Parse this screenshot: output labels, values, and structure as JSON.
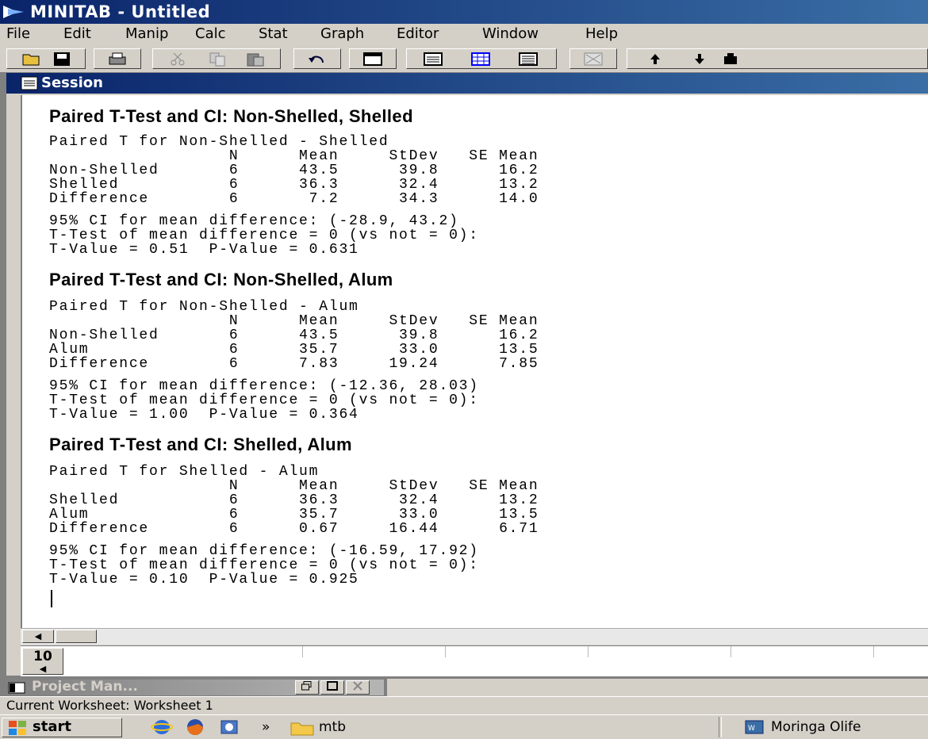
{
  "app": {
    "title": "MINITAB - Untitled"
  },
  "menu": [
    "File",
    "Edit",
    "Manip",
    "Calc",
    "Stat",
    "Graph",
    "Editor",
    "Window",
    "Help"
  ],
  "toolbar_icons": [
    "open-icon",
    "save-icon",
    "print-icon",
    "cut-icon",
    "copy-icon",
    "paste-icon",
    "undo-icon",
    "data-window-icon",
    "session-window-icon",
    "worksheet-icon",
    "info-icon",
    "history-icon",
    "up-arrow-icon",
    "down-arrow-icon",
    "more-icon"
  ],
  "session": {
    "title": "Session",
    "blocks": [
      {
        "header": "Paired T-Test and CI: Non-Shelled, Shelled",
        "lines": [
          "Paired T for Non-Shelled - Shelled",
          "                  N      Mean     StDev   SE Mean",
          "Non-Shelled       6      43.5      39.8      16.2",
          "Shelled           6      36.3      32.4      13.2",
          "Difference        6       7.2      34.3      14.0",
          "",
          "95% CI for mean difference: (-28.9, 43.2)",
          "T-Test of mean difference = 0 (vs not = 0):",
          "T-Value = 0.51  P-Value = 0.631"
        ]
      },
      {
        "header": "Paired T-Test and CI: Non-Shelled, Alum",
        "lines": [
          "Paired T for Non-Shelled - Alum",
          "                  N      Mean     StDev   SE Mean",
          "Non-Shelled       6      43.5      39.8      16.2",
          "Alum              6      35.7      33.0      13.5",
          "Difference        6      7.83     19.24      7.85",
          "",
          "95% CI for mean difference: (-12.36, 28.03)",
          "T-Test of mean difference = 0 (vs not = 0):",
          "T-Value = 1.00  P-Value = 0.364"
        ]
      },
      {
        "header": "Paired T-Test and CI: Shelled, Alum",
        "lines": [
          "Paired T for Shelled - Alum",
          "                  N      Mean     StDev   SE Mean",
          "Shelled           6      36.3      32.4      13.2",
          "Alum              6      35.7      33.0      13.5",
          "Difference        6      0.67     16.44      6.71",
          "",
          "95% CI for mean difference: (-16.59, 17.92)",
          "T-Test of mean difference = 0 (vs not = 0):",
          "T-Value = 0.10  P-Value = 0.925"
        ]
      }
    ]
  },
  "worksheet": {
    "row_number": "10"
  },
  "project_manager": {
    "title": "Project Man..."
  },
  "status": {
    "text": "Current Worksheet: Worksheet 1"
  },
  "taskbar": {
    "start": "start",
    "chevron": "»",
    "folder": "mtb",
    "app": "Moringa Olife"
  }
}
